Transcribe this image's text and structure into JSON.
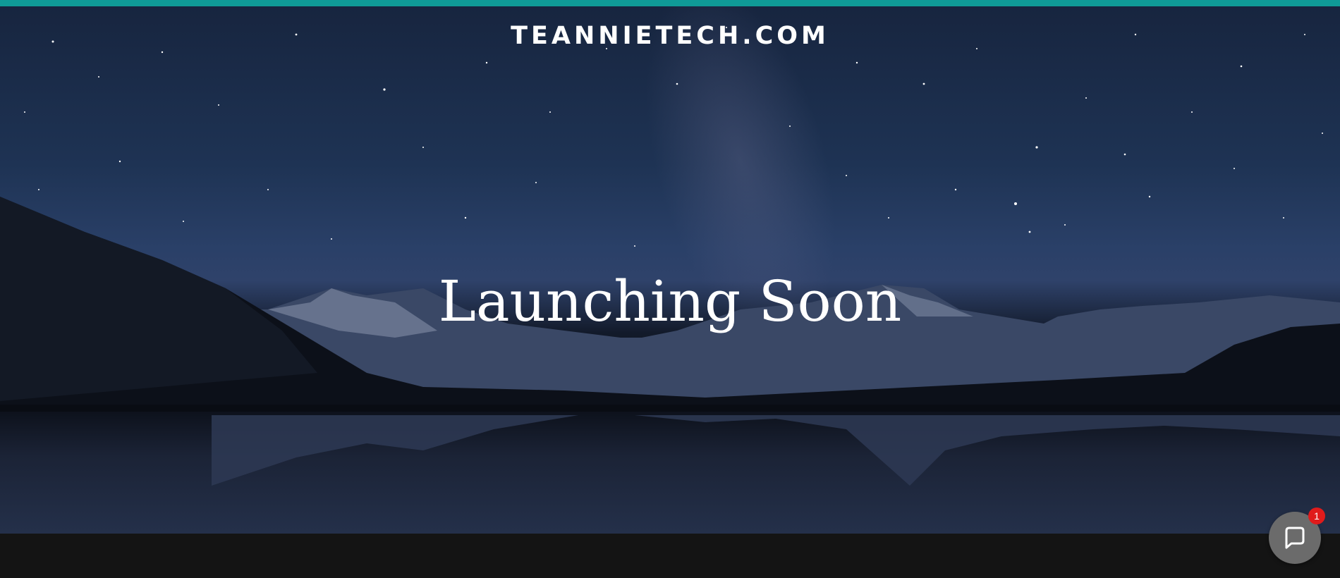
{
  "header": {
    "site_title": "TEANNIETECH.COM"
  },
  "hero": {
    "headline": "Launching Soon"
  },
  "chat_widget": {
    "icon": "chat-bubble-icon",
    "unread_count": "1"
  },
  "colors": {
    "accent": "#0f9a97",
    "badge": "#e01b1b",
    "footer": "#141414"
  }
}
